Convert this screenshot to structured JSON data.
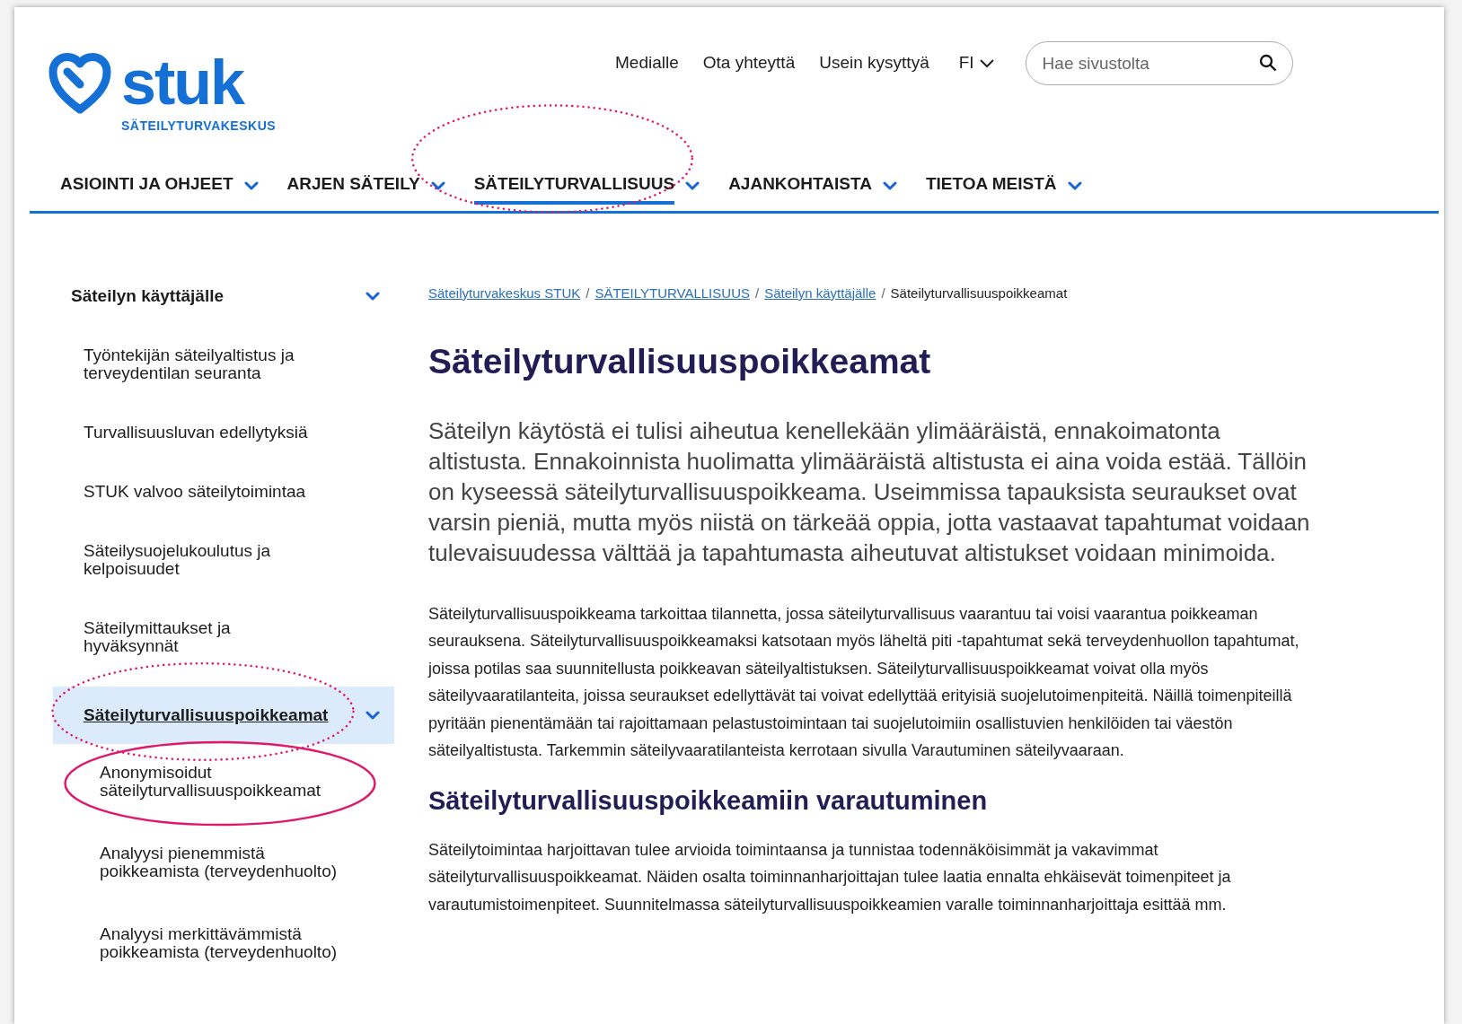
{
  "logo": {
    "wordmark": "stuk",
    "tagline": "SÄTEILYTURVAKESKUS"
  },
  "top_links": [
    "Medialle",
    "Ota yhteyttä",
    "Usein kysyttyä"
  ],
  "language": {
    "label": "FI"
  },
  "search": {
    "placeholder": "Hae sivustolta"
  },
  "main_nav": [
    {
      "label": "ASIOINTI JA OHJEET",
      "selected": false,
      "circled": false
    },
    {
      "label": "ARJEN SÄTEILY",
      "selected": false,
      "circled": false
    },
    {
      "label": "SÄTEILYTURVALLISUUS",
      "selected": true,
      "circled": true,
      "dotted": true
    },
    {
      "label": "AJANKOHTAISTA",
      "selected": false,
      "circled": false
    },
    {
      "label": "TIETOA MEISTÄ",
      "selected": false,
      "circled": false
    }
  ],
  "sidebar": {
    "title": "Säteilyn käyttäjälle",
    "expanded": true,
    "items": [
      {
        "label": "Työntekijän säteilyaltistus ja terveydentilan seuranta",
        "selected": false,
        "circled": false
      },
      {
        "label": "Turvallisuusluvan edellytyksiä",
        "selected": false,
        "circled": false
      },
      {
        "label": "STUK valvoo säteilytoimintaa",
        "selected": false,
        "circled": false
      },
      {
        "label": "Säteilysuojelukoulutus ja kelpoisuudet",
        "selected": false,
        "circled": false
      },
      {
        "label": "Säteilymittaukset ja hyväksynnät",
        "selected": false,
        "circled": false
      },
      {
        "label": "Säteilyturvallisuuspoikkeamat",
        "selected": true,
        "circled": true,
        "dotted": true,
        "expanded": true,
        "children": [
          {
            "label": "Anonymisoidut säteilyturvallisuuspoikkeamat",
            "selected": false,
            "circled": true,
            "dotted": false
          },
          {
            "label": "Analyysi pienemmistä poikkeamista (terveydenhuolto)",
            "selected": false,
            "circled": false
          },
          {
            "label": "Analyysi merkittävämmistä poikkeamista (terveydenhuolto)",
            "selected": false,
            "circled": false
          }
        ]
      }
    ]
  },
  "breadcrumb": [
    {
      "label": "Säteilyturvakeskus STUK",
      "link": true
    },
    {
      "separator": "/",
      "label": "SÄTEILYTURVALLISUUS",
      "link": true
    },
    {
      "separator": "/",
      "label": "Säteilyn käyttäjälle",
      "link": true
    },
    {
      "separator": "/",
      "label": "Säteilyturvallisuuspoikkeamat",
      "link": false
    }
  ],
  "page_title": "Säteilyturvallisuuspoikkeamat",
  "lead": "Säteilyn käytöstä ei tulisi aiheutua kenellekään ylimääräistä, ennakoimatonta altistusta. Ennakoinnista huolimatta ylimääräistä altistusta ei aina voida estää. Tällöin on kyseessä säteilyturvallisuuspoikkeama. Useimmissa tapauksista seuraukset ovat varsin pieniä, mutta myös niistä on tärkeää oppia, jotta vastaavat tapahtumat voidaan tulevaisuudessa välttää ja tapahtumasta aiheutuvat altistukset voidaan minimoida.",
  "body": "Säteilyturvallisuuspoikkeama tarkoittaa tilannetta, jossa säteilyturvallisuus vaarantuu tai voisi vaarantua poikkeaman seurauksena. Säteilyturvallisuuspoikkeamaksi katsotaan myös läheltä piti -tapahtumat sekä terveydenhuollon tapahtumat, joissa potilas saa suunnitellusta poikkeavan säteilyaltistuksen. Säteilyturvallisuuspoikkeamat voivat olla myös säteilyvaaratilanteita, joissa seuraukset edellyttävät tai voivat edellyttää erityisiä suojelutoimenpiteitä. Näillä toimenpiteillä pyritään pienentämään tai rajoittamaan pelastustoimintaan tai suojelutoimiin osallistuvien henkilöiden tai väestön säteilyaltistusta. Tarkemmin säteilyvaaratilanteista kerrotaan sivulla Varautuminen säteilyvaaraan.",
  "section_heading": "Säteilyturvallisuuspoikkeamiin varautuminen",
  "section_body": "Säteilytoimintaa harjoittavan tulee arvioida toimintaansa ja tunnistaa todennäköisimmät ja vakavimmat säteilyturvallisuuspoikkeamat. Näiden osalta toiminnanharjoittajan tulee laatia ennalta ehkäisevät toimenpiteet ja varautumistoimenpiteet. Suunnitelmassa säteilyturvallisuuspoikkeamien varalle toiminnanharjoittaja esittää mm."
}
